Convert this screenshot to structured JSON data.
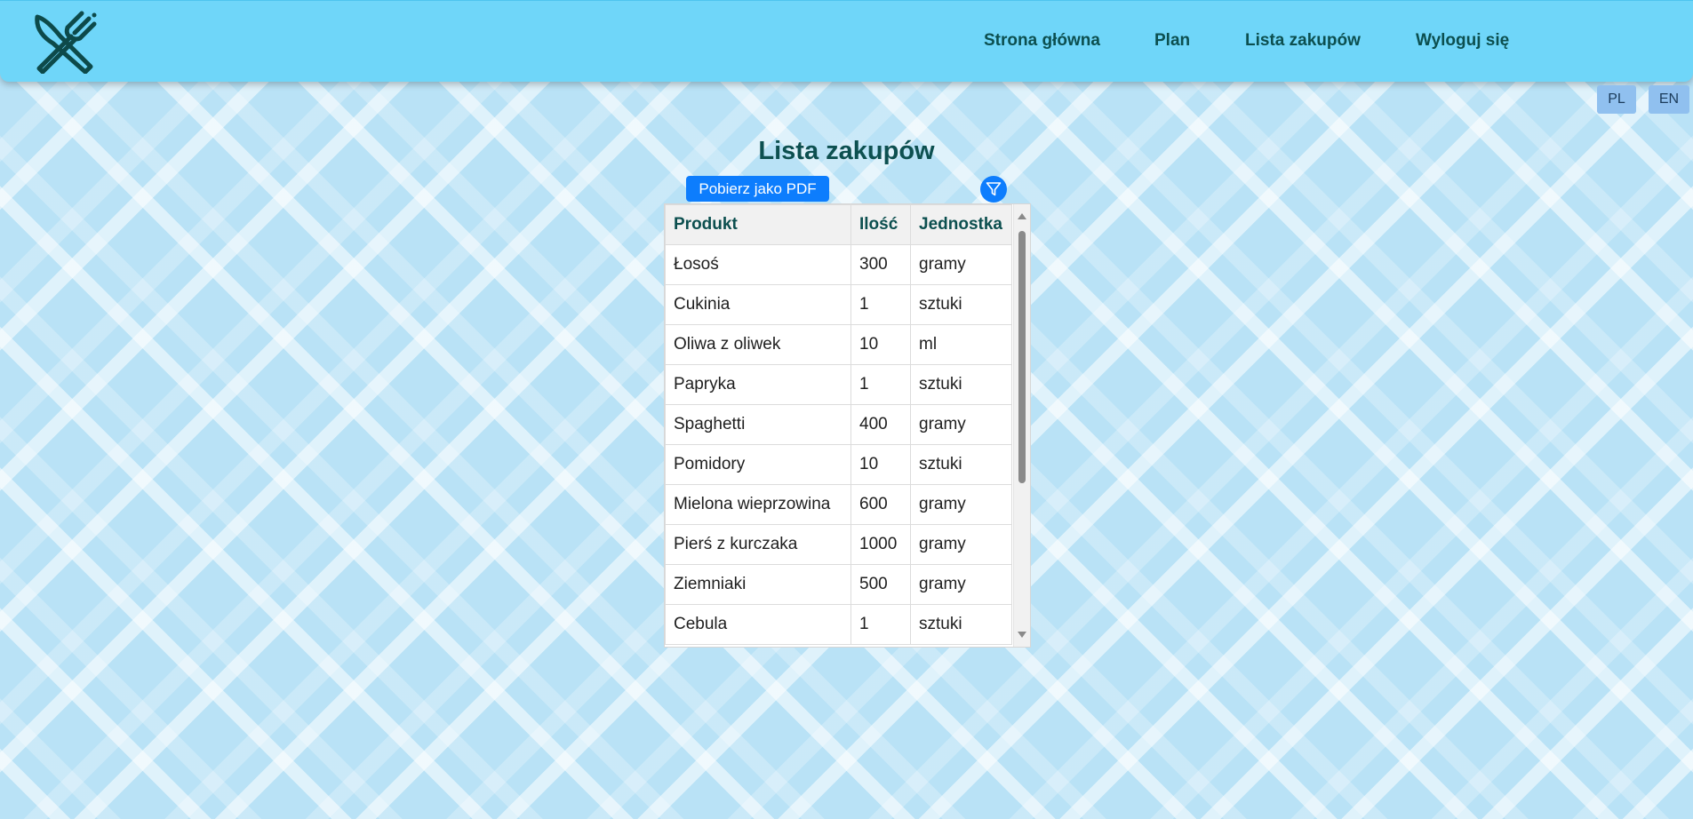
{
  "nav": {
    "logo_icon": "fork-knife-icon",
    "links": [
      {
        "label": "Strona główna"
      },
      {
        "label": "Plan"
      },
      {
        "label": "Lista zakupów"
      },
      {
        "label": "Wyloguj się"
      }
    ]
  },
  "language": {
    "pl": "PL",
    "en": "EN"
  },
  "page": {
    "title": "Lista zakupów",
    "pdf_button": "Pobierz jako PDF",
    "filter_icon": "filter-icon"
  },
  "table": {
    "headers": [
      "Produkt",
      "Ilość",
      "Jednostka"
    ],
    "rows": [
      [
        "Łosoś",
        "300",
        "gramy"
      ],
      [
        "Cukinia",
        "1",
        "sztuki"
      ],
      [
        "Oliwa z oliwek",
        "10",
        "ml"
      ],
      [
        "Papryka",
        "1",
        "sztuki"
      ],
      [
        "Spaghetti",
        "400",
        "gramy"
      ],
      [
        "Pomidory",
        "10",
        "sztuki"
      ],
      [
        "Mielona wieprzowina",
        "600",
        "gramy"
      ],
      [
        "Pierś z kurczaka",
        "1000",
        "gramy"
      ],
      [
        "Ziemniaki",
        "500",
        "gramy"
      ],
      [
        "Cebula",
        "1",
        "sztuki"
      ]
    ]
  },
  "colors": {
    "navbar": "#6fd6f9",
    "nav_text": "#0c4f4f",
    "primary_button": "#0d7dfd",
    "lang_button": "#90c0ef"
  }
}
